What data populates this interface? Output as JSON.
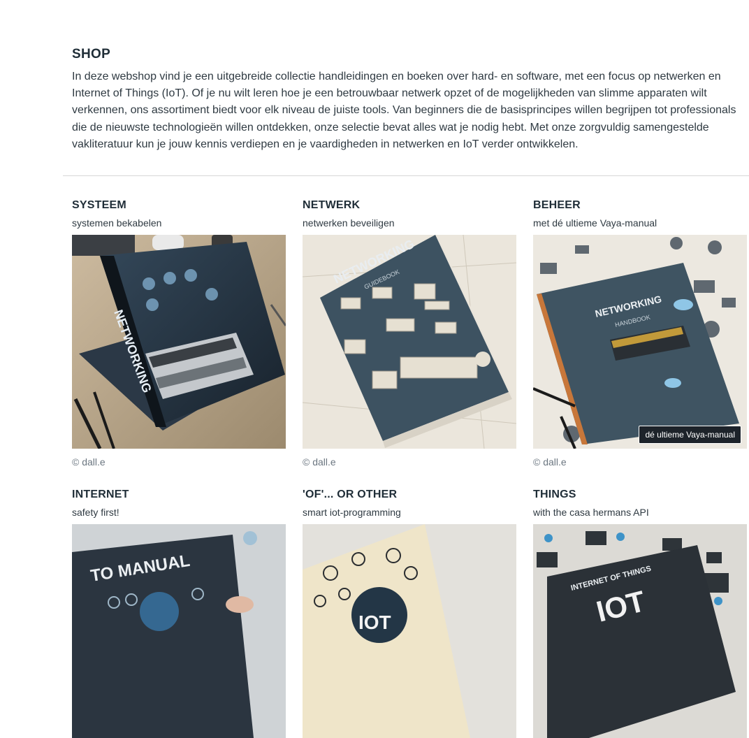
{
  "intro": {
    "title": "SHOP",
    "text": "In deze webshop vind je een uitgebreide collectie handleidingen en boeken over hard- en software, met een focus op netwerken en Internet of Things (IoT). Of je nu wilt leren hoe je een betrouwbaar netwerk opzet of de mogelijkheden van slimme apparaten wilt verkennen, ons assortiment biedt voor elk niveau de juiste tools. Van beginners die de basisprincipes willen begrijpen tot professionals die de nieuwste technologieën willen ontdekken, onze selectie bevat alles wat je nodig hebt. Met onze zorgvuldig samengestelde vakliteratuur kun je jouw kennis verdiepen en je vaardigheden in netwerken en IoT verder ontwikkelen."
  },
  "cards": [
    {
      "title": "SYSTEEM",
      "subtitle": "systemen bekabelen",
      "cover_text": "NETWORKING",
      "cover_sub": "",
      "credit": "© dall.e"
    },
    {
      "title": "NETWERK",
      "subtitle": "netwerken beveiligen",
      "cover_text": "NETWORKING",
      "cover_sub": "GUIDEBOOK",
      "credit": "© dall.e"
    },
    {
      "title": "BEHEER",
      "subtitle": "met dé ultieme Vaya-manual",
      "cover_text": "NETWORKING",
      "cover_sub": "HANDBOOK",
      "credit": "© dall.e",
      "tooltip": "dé ultieme Vaya-manual"
    },
    {
      "title": "INTERNET",
      "subtitle": "safety first!",
      "cover_text": "TO MANUAL",
      "cover_sub": "",
      "credit": ""
    },
    {
      "title": "'OF'... OR OTHER",
      "subtitle": "smart iot-programming",
      "cover_text": "IOT",
      "cover_sub": "",
      "credit": ""
    },
    {
      "title": "THINGS",
      "subtitle": "with the casa hermans API",
      "cover_text": "IOT",
      "cover_sub": "INTERNET OF THINGS",
      "credit": ""
    }
  ],
  "colors": {
    "heading": "#1f2d37",
    "text": "#2f3a42",
    "credit": "#6b7680",
    "divider": "#d7d7d7"
  }
}
